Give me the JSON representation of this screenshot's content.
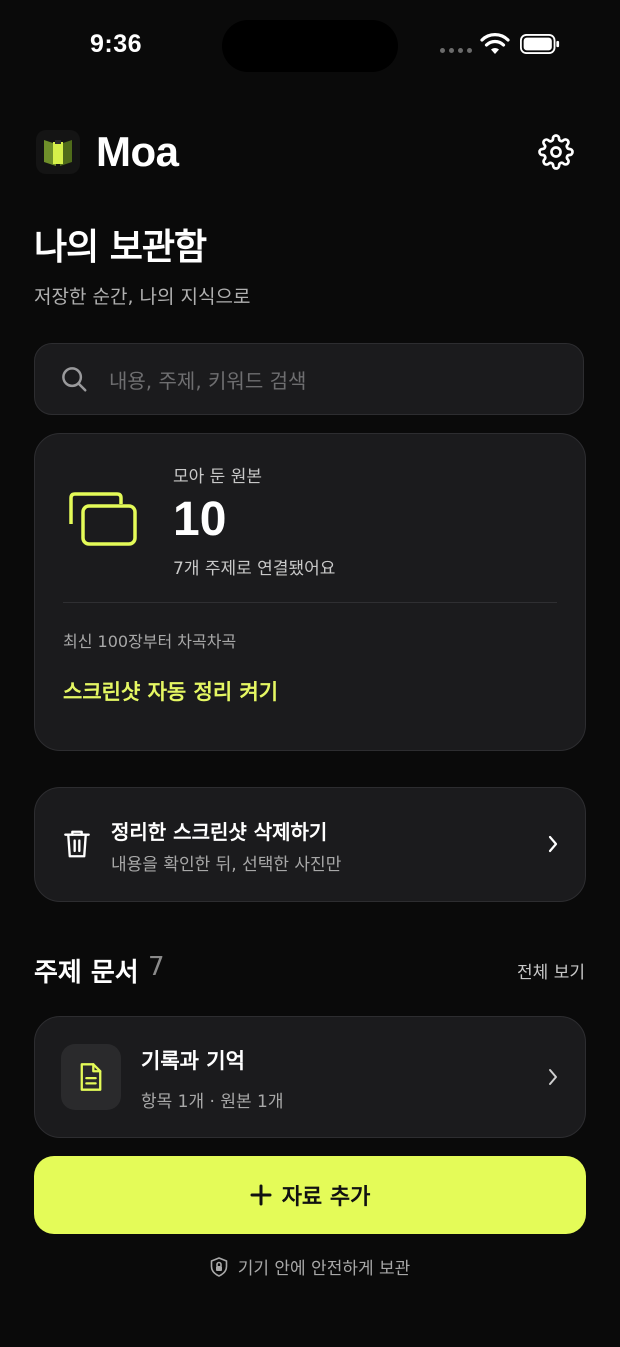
{
  "status_bar": {
    "time": "9:36"
  },
  "header": {
    "app_name": "Moa"
  },
  "page": {
    "title": "나의 보관함",
    "subtitle": "저장한 순간, 나의 지식으로"
  },
  "search": {
    "placeholder": "내용, 주제, 키워드 검색",
    "value": ""
  },
  "stats": {
    "label": "모아 둔 원본",
    "value": "10",
    "sub": "7개 주제로 연결됐어요",
    "hint": "최신 100장부터 차곡차곡",
    "action": "스크린샷 자동 정리 켜기"
  },
  "cleanup": {
    "title": "정리한 스크린샷 삭제하기",
    "subtitle": "내용을 확인한 뒤, 선택한 사진만"
  },
  "topics": {
    "title": "주제 문서",
    "count": "7",
    "view_all": "전체 보기",
    "items": [
      {
        "title": "기록과 기억",
        "meta": "항목 1개 · 원본 1개"
      }
    ]
  },
  "add_button": {
    "label": "자료 추가"
  },
  "footer": {
    "text": "기기 안에 안전하게 보관"
  },
  "colors": {
    "accent": "#e4fb58",
    "background": "#0a0a0a",
    "card": "#1b1b1d"
  }
}
